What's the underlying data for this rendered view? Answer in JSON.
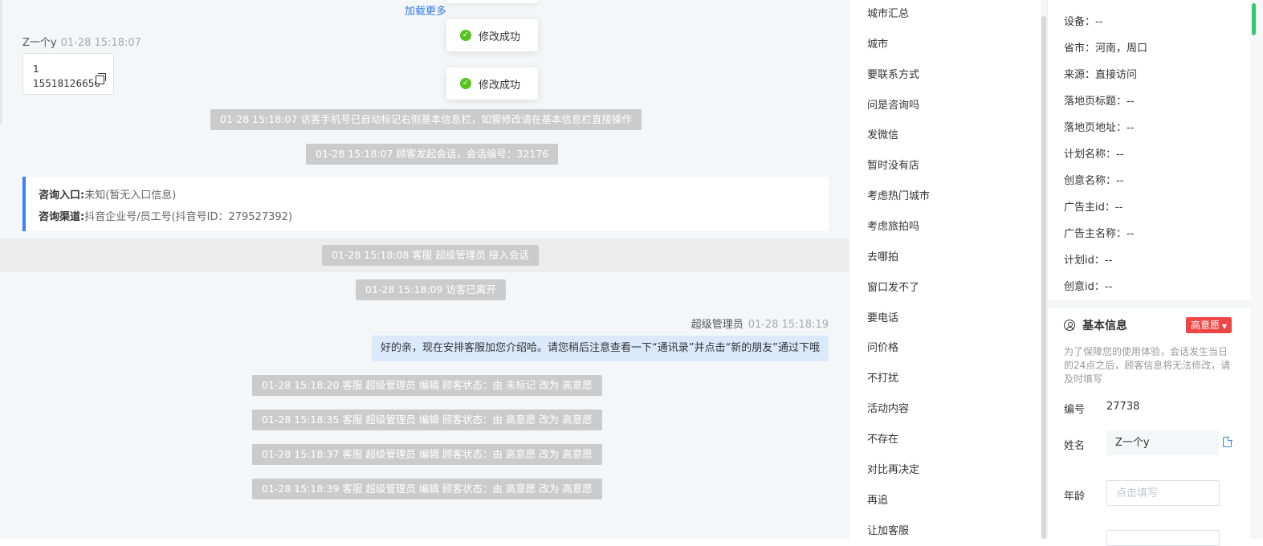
{
  "chat": {
    "load_more": "加载更多",
    "toasts": [
      "修改成功",
      "修改成功"
    ],
    "visitor": {
      "name": "Z一个y",
      "time": "01-28 15:18:07",
      "bubble_line1": "1",
      "bubble_line2": "15518126656"
    },
    "system_messages": [
      "01-28 15:18:07 访客手机号已自动标记右侧基本信息栏，如需修改请在基本信息栏直接操作",
      "01-28 15:18:07 顾客发起会话，会话编号：32176"
    ],
    "consult_info": {
      "entry_label": "咨询入口:",
      "entry_value": "未知(暂无入口信息)",
      "channel_label": "咨询渠道:",
      "channel_value": "抖音企业号/员工号(抖音号ID：279527392)"
    },
    "session_messages": [
      "01-28 15:18:08 客服 超级管理员 接入会话",
      "01-28 15:18:09 访客已离开"
    ],
    "agent": {
      "name": "超级管理员",
      "time": "01-28 15:18:19",
      "message": "好的亲，现在安排客服加您介绍哈。请您稍后注意查看一下“通讯录”并点击“新的朋友”通过下哦"
    },
    "edit_logs": [
      "01-28 15:18:20 客服 超级管理员 编辑 顾客状态：由 未标记 改为 高意愿",
      "01-28 15:18:35 客服 超级管理员 编辑 顾客状态：由 高意愿 改为 高意愿",
      "01-28 15:18:37 客服 超级管理员 编辑 顾客状态：由 高意愿 改为 高意愿",
      "01-28 15:18:39 客服 超级管理员 编辑 顾客状态：由 高意愿 改为 高意愿"
    ]
  },
  "tags": [
    "城市汇总",
    "城市",
    "要联系方式",
    "问是咨询吗",
    "发微信",
    "暂时没有店",
    "考虑热门城市",
    "考虑旅拍吗",
    "去哪拍",
    "窗口发不了",
    "要电话",
    "问价格",
    "不打扰",
    "活动内容",
    "不存在",
    "对比再决定",
    "再追",
    "让加客服"
  ],
  "source_info": [
    {
      "label": "设备：",
      "value": "--"
    },
    {
      "label": "省市：",
      "value": "河南，周口"
    },
    {
      "label": "来源：",
      "value": "直接访问"
    },
    {
      "label": "落地页标题：",
      "value": "--"
    },
    {
      "label": "落地页地址：",
      "value": "--"
    },
    {
      "label": "计划名称：",
      "value": "--"
    },
    {
      "label": "创意名称：",
      "value": "--"
    },
    {
      "label": "广告主id：",
      "value": "--"
    },
    {
      "label": "广告主名称：",
      "value": "--"
    },
    {
      "label": "计划id：",
      "value": "--"
    },
    {
      "label": "创意id：",
      "value": "--"
    }
  ],
  "basic_info": {
    "title": "基本信息",
    "intent_badge": "高意愿",
    "notice": "为了保障您的使用体验，会话发生当日的24点之后，顾客信息将无法修改，请及时填写",
    "id_label": "编号",
    "id_value": "27738",
    "name_label": "姓名",
    "name_value": "Z一个y",
    "age_label": "年龄",
    "age_placeholder": "点击填写"
  },
  "colors": {
    "accent_blue": "#3f80f4",
    "badge_red": "#f04545",
    "success_green": "#52c41a",
    "system_msg_gray": "#cbcbcb",
    "agent_bubble": "#dbe9fd"
  }
}
